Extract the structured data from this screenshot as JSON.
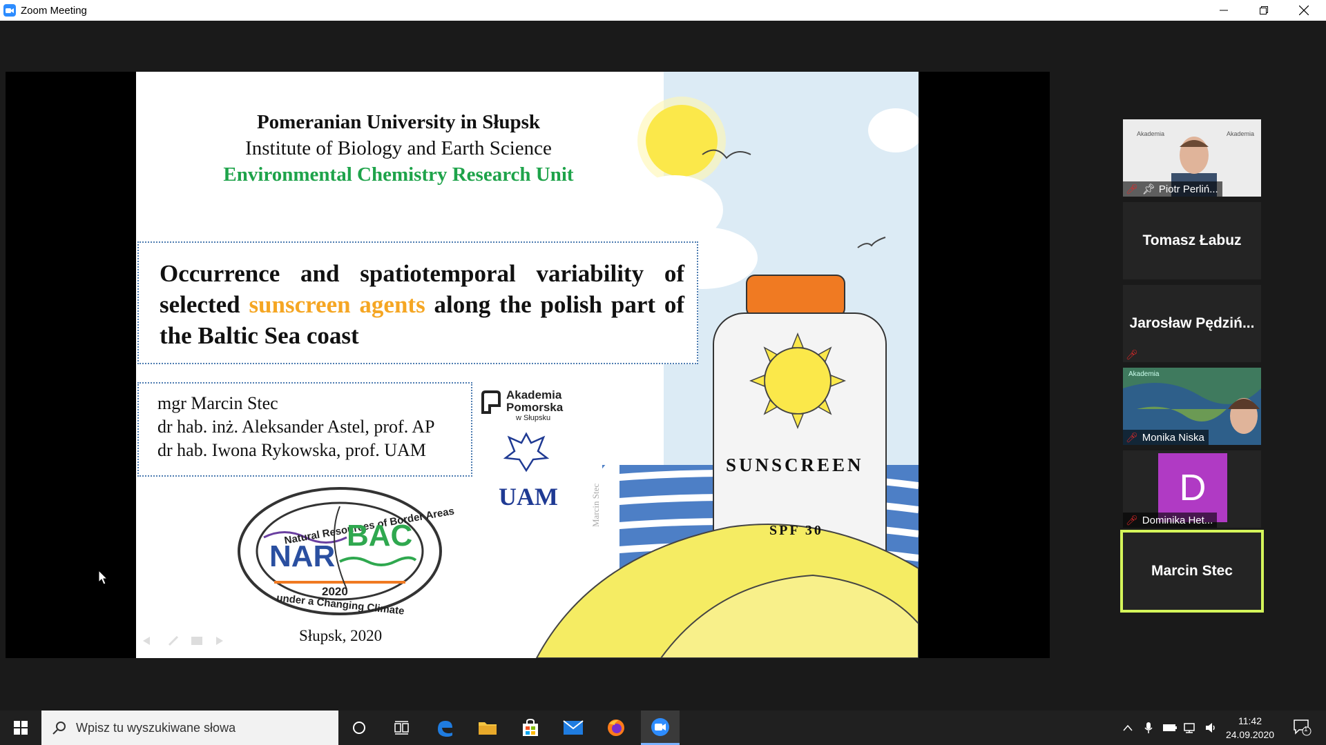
{
  "window": {
    "title": "Zoom Meeting"
  },
  "slide": {
    "university": "Pomeranian University in Słupsk",
    "institute": "Institute of Biology and Earth Science",
    "unit": "Environmental Chemistry Research  Unit",
    "title_part1": "Occurrence and spatiotemporal variability of selected ",
    "title_highlight": "sunscreen agents",
    "title_part2": " along the polish part of the Baltic Sea coast",
    "authors": [
      "mgr Marcin Stec",
      "dr hab. inż. Aleksander Astel, prof. AP",
      "dr hab. Iwona Rykowska, prof. UAM"
    ],
    "city_year": "Słupsk, 2020",
    "logo_ap_line1": "Akademia",
    "logo_ap_line2": "Pomorska",
    "logo_ap_line3": "w Słupsku",
    "logo_uam": "UAM",
    "narbac_top": "Natural Resources of Border Areas",
    "narbac_bottom": "under a Changing Climate",
    "narbac_nar": "NAR",
    "narbac_bac": "BAC",
    "narbac_year": "2020",
    "bottle_label": "SUNSCREEN",
    "bottle_spf": "SPF 30",
    "watermark": "Marcin Stec",
    "accent_green": "#1ea34a",
    "accent_orange": "#f5a623"
  },
  "participants": [
    {
      "name": "Piotr Perliń...",
      "type": "video",
      "muted": true,
      "pinned": true
    },
    {
      "name": "Tomasz Łabuz",
      "type": "name"
    },
    {
      "name": "Jarosław  Pędziń...",
      "type": "name",
      "muted": true
    },
    {
      "name": "Monika Niska",
      "type": "video",
      "muted": true
    },
    {
      "name": "Dominika Het...",
      "type": "avatar",
      "initial": "D",
      "muted": true
    },
    {
      "name": "Marcin Stec",
      "type": "name",
      "active_speaker": true
    }
  ],
  "taskbar": {
    "search_placeholder": "Wpisz tu wyszukiwane słowa",
    "time": "11:42",
    "date": "24.09.2020",
    "notifications": "1"
  }
}
